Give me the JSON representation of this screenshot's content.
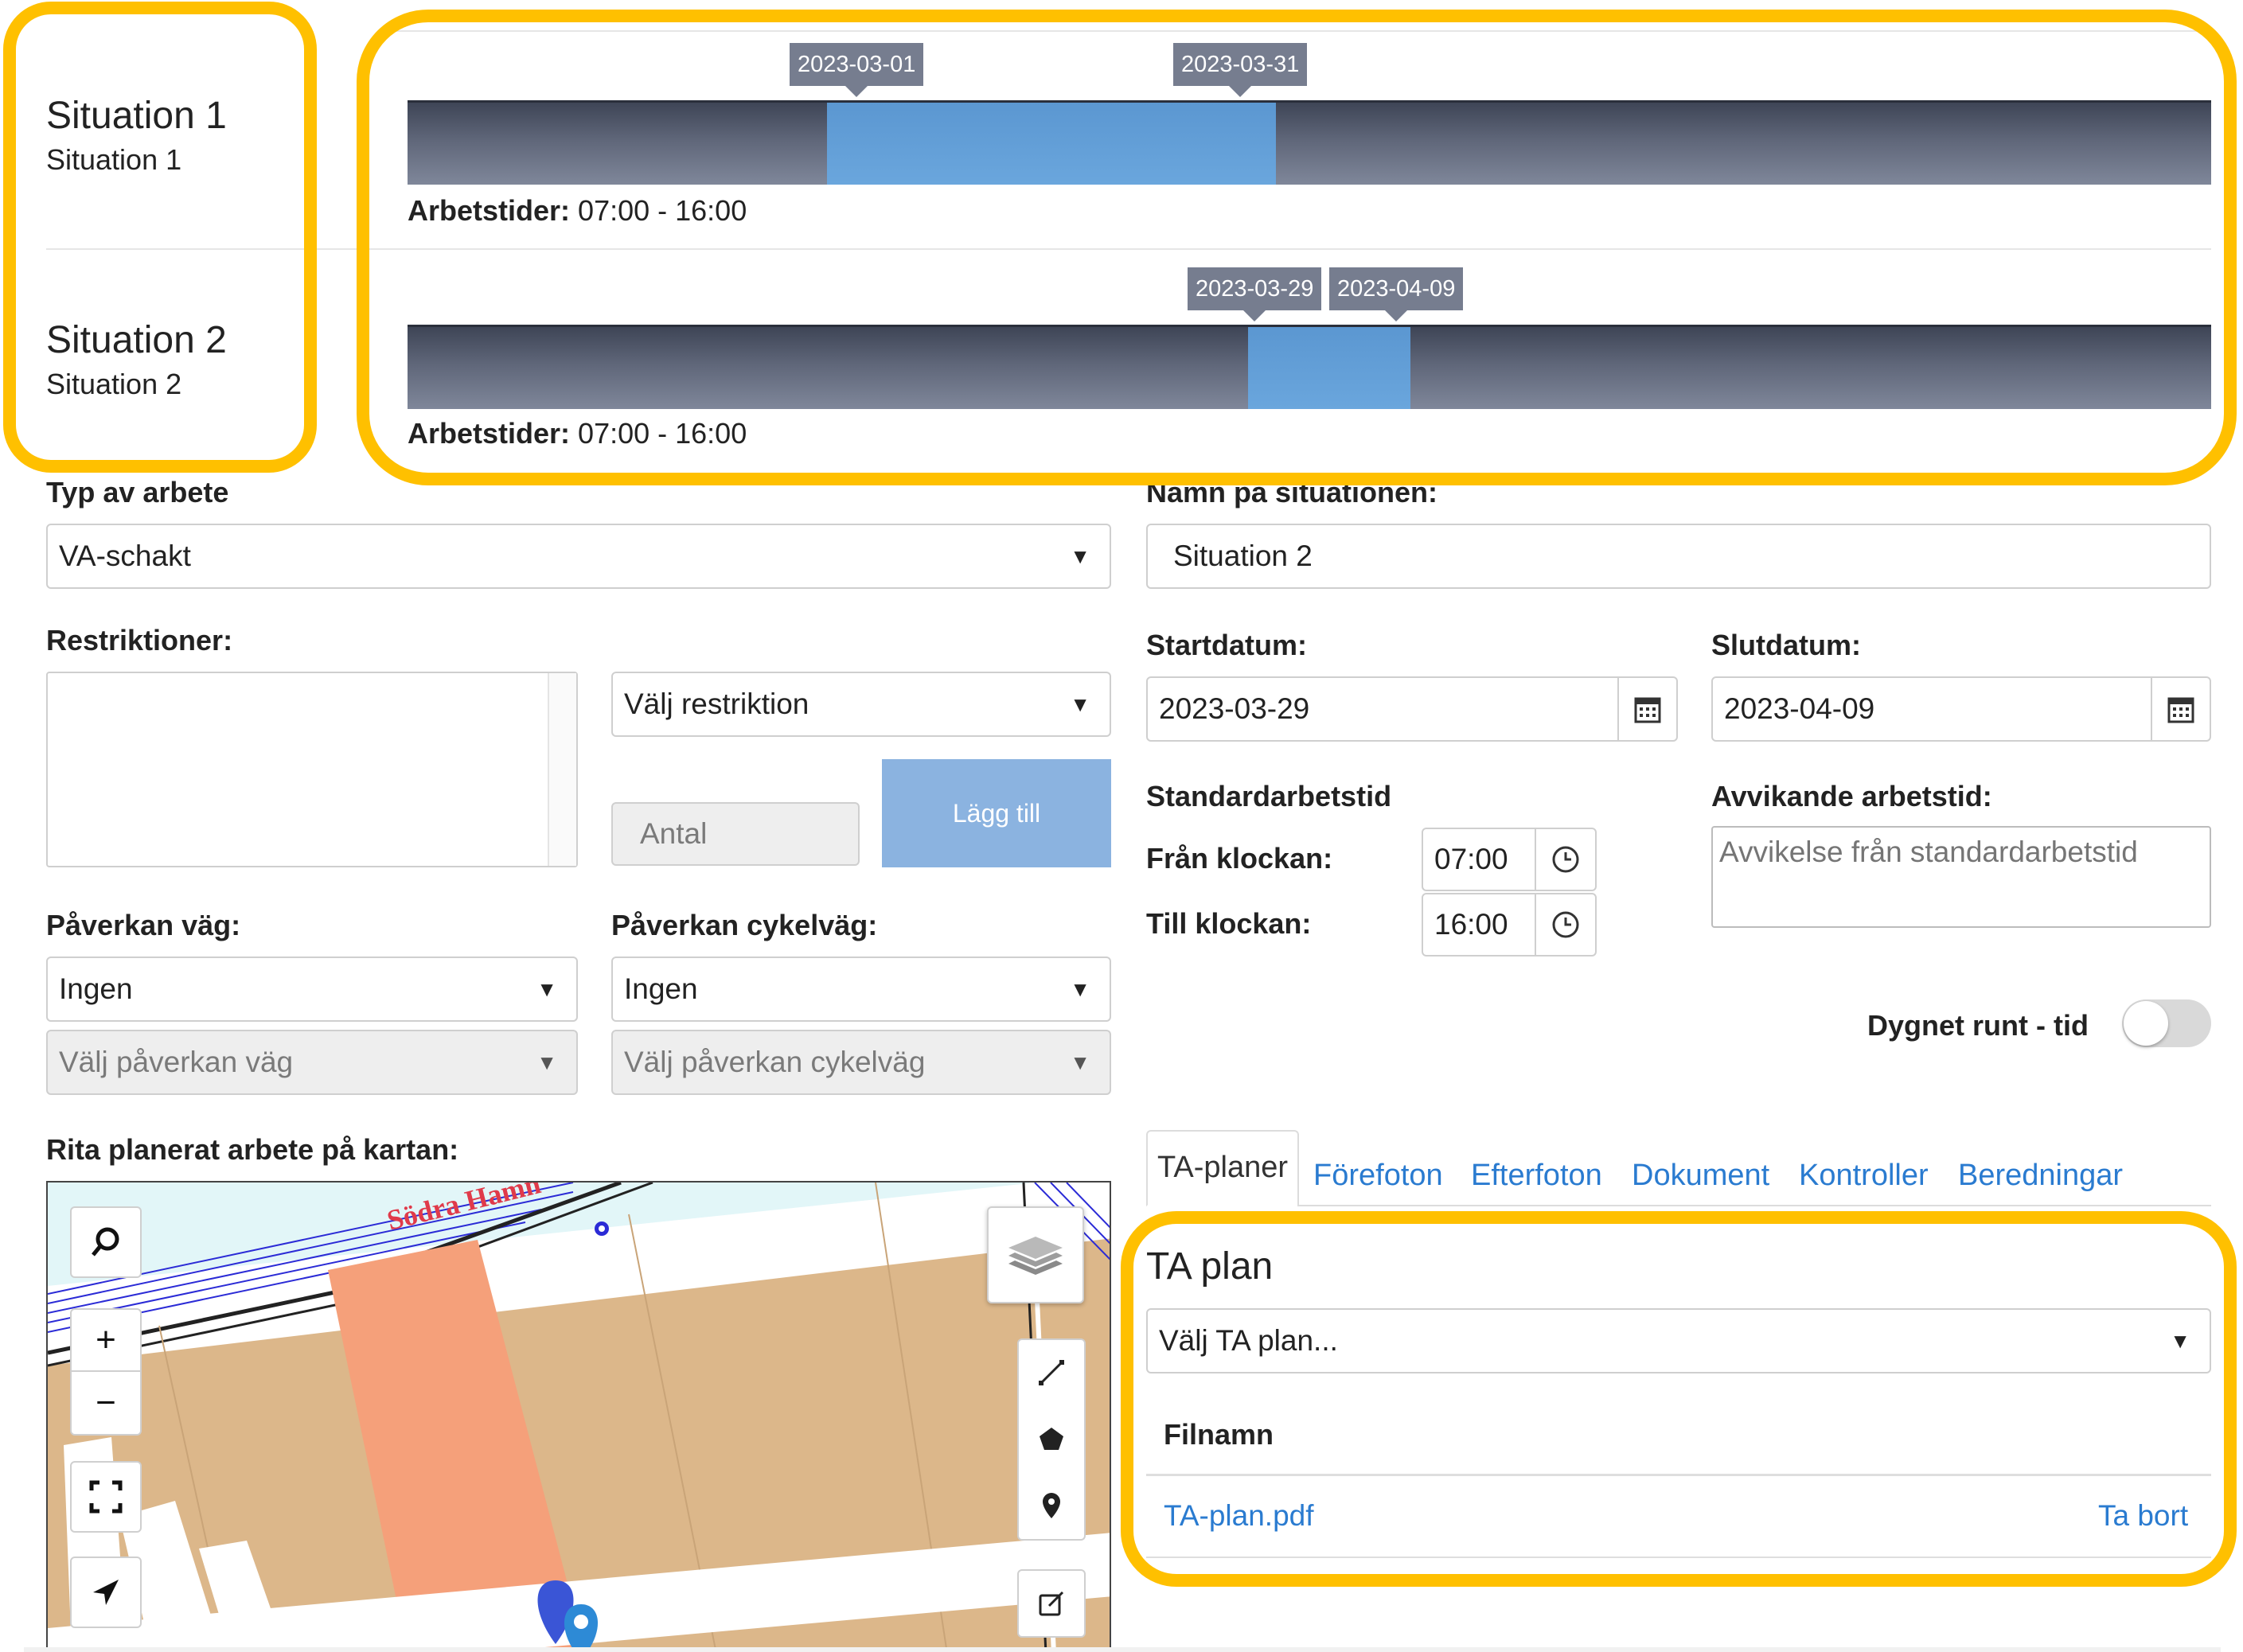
{
  "situations": [
    {
      "title": "Situation 1",
      "subtitle": "Situation 1",
      "start": "2023-03-01",
      "end": "2023-03-31",
      "range_fraction": [
        0.233,
        0.481
      ],
      "work_hours_label": "Arbetstider:",
      "work_hours": "07:00 - 16:00"
    },
    {
      "title": "Situation 2",
      "subtitle": "Situation 2",
      "start": "2023-03-29",
      "end": "2023-04-09",
      "range_fraction": [
        0.466,
        0.556
      ],
      "work_hours_label": "Arbetstider:",
      "work_hours": "07:00 - 16:00"
    }
  ],
  "form": {
    "type_label": "Typ av arbete",
    "type_value": "VA-schakt",
    "name_label": "Namn på situationen:",
    "name_value": "Situation 2",
    "restrictions_label": "Restriktioner:",
    "restriction_select": "Välj restriktion",
    "count_placeholder": "Antal",
    "add_button": "Lägg till",
    "start_label": "Startdatum:",
    "start_value": "2023-03-29",
    "end_label": "Slutdatum:",
    "end_value": "2023-04-09",
    "std_time_label": "Standardarbetstid",
    "from_label": "Från klockan:",
    "from_value": "07:00",
    "to_label": "Till klockan:",
    "to_value": "16:00",
    "deviating_label": "Avvikande arbetstid:",
    "deviating_placeholder": "Avvikelse från standardarbetstid",
    "road_label": "Påverkan väg:",
    "road_value": "Ingen",
    "road_sub": "Välj påverkan väg",
    "bike_label": "Påverkan cykelväg:",
    "bike_value": "Ingen",
    "bike_sub": "Välj påverkan cykelväg",
    "allday_label": "Dygnet runt - tid",
    "allday_on": false,
    "map_label": "Rita planerat arbete på kartan:",
    "map_street": "Södra Hamn"
  },
  "tabs": [
    "TA-planer",
    "Förefoton",
    "Efterfoton",
    "Dokument",
    "Kontroller",
    "Beredningar"
  ],
  "ta_plan": {
    "title": "TA plan",
    "select": "Välj TA plan...",
    "file_header": "Filnamn",
    "file_name": "TA-plan.pdf",
    "remove": "Ta bort"
  },
  "colors": {
    "highlight": "#ffc000",
    "range": "#6aa6dd",
    "link": "#2a7bd0",
    "parcel": "#dcb78a",
    "work_area": "#f5a07a"
  }
}
